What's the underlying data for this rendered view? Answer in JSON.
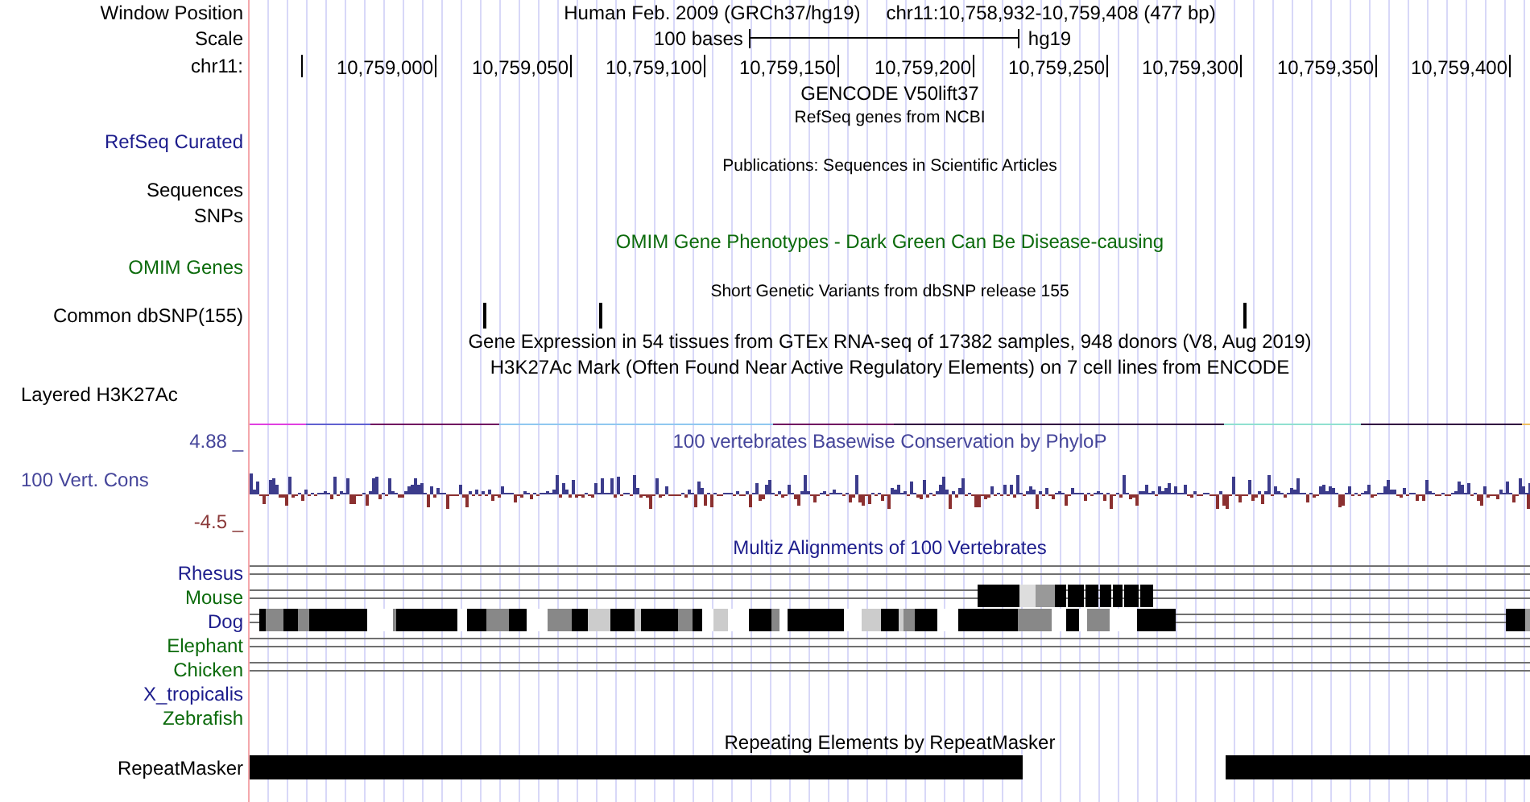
{
  "rows": [
    {
      "kind": "position",
      "label": {
        "text": "Window Position",
        "color": "#000000"
      },
      "assembly": "Human Feb. 2009 (GRCh37/hg19)",
      "position": "chr11:10,758,932-10,759,408 (477 bp)"
    },
    {
      "kind": "scale",
      "label": {
        "text": "Scale",
        "color": "#000000"
      },
      "length": "100 bases",
      "database": "hg19"
    },
    {
      "kind": "ruler",
      "label": {
        "text": "chr11:",
        "color": "#000000"
      },
      "ticks": [
        "10,759,000",
        "10,759,050",
        "10,759,100",
        "10,759,150",
        "10,759,200",
        "10,759,250",
        "10,759,300",
        "10,759,350",
        "10,759,400"
      ]
    },
    {
      "kind": "title",
      "title": {
        "text": "GENCODE V50lift37",
        "color": "#000000"
      }
    },
    {
      "kind": "note",
      "title": {
        "text": "RefSeq genes from NCBI",
        "color": "#000000"
      }
    },
    {
      "kind": "label",
      "label": {
        "text": "RefSeq Curated",
        "color": "#1c1c8c"
      }
    },
    {
      "kind": "note",
      "title": {
        "text": "Publications: Sequences in Scientific Articles",
        "color": "#000000"
      }
    },
    {
      "kind": "label",
      "label": {
        "text": "Sequences",
        "color": "#000000"
      }
    },
    {
      "kind": "label",
      "label": {
        "text": "SNPs",
        "color": "#000000"
      }
    },
    {
      "kind": "title",
      "title": {
        "text": "OMIM Gene Phenotypes - Dark Green Can Be Disease-causing",
        "color": "#0c6b0c"
      }
    },
    {
      "kind": "label",
      "label": {
        "text": "OMIM Genes",
        "color": "#0c6b0c"
      }
    },
    {
      "kind": "note",
      "title": {
        "text": "Short Genetic Variants from dbSNP release 155",
        "color": "#000000"
      }
    },
    {
      "kind": "snps",
      "label": {
        "text": "Common dbSNP(155)",
        "color": "#000000"
      }
    },
    {
      "kind": "title",
      "title": {
        "text": "Gene Expression in 54 tissues from GTEx RNA-seq of 17382 samples, 948 donors (V8, Aug 2019)",
        "color": "#000000"
      }
    },
    {
      "kind": "title",
      "title": {
        "text": "H3K27Ac Mark (Often Found Near Active Regulatory Elements) on 7 cell lines from ENCODE",
        "color": "#000000"
      }
    },
    {
      "kind": "composite",
      "label": {
        "text": "Layered H3K27Ac",
        "color": "#000000"
      }
    },
    {
      "kind": "signal"
    },
    {
      "kind": "axis",
      "label": {
        "text": "4.88 _",
        "color": "#45459a"
      },
      "title": {
        "text": "100 vertebrates Basewise Conservation by PhyloP",
        "color": "#45459a"
      }
    },
    {
      "kind": "wiggle",
      "label": {
        "text": "100 Vert. Cons",
        "color": "#45459a"
      }
    },
    {
      "kind": "axis",
      "label": {
        "text": "-4.5 _",
        "color": "#8b3a3a"
      }
    },
    {
      "kind": "title",
      "title": {
        "text": "Multiz Alignments of 100 Vertebrates",
        "color": "#1c1c8c"
      }
    },
    {
      "kind": "alignment",
      "label": {
        "text": "Rhesus",
        "color": "#1c1c8c"
      },
      "lines": true
    },
    {
      "kind": "alignment",
      "label": {
        "text": "Mouse",
        "color": "#0c6b0c"
      },
      "lines": true
    },
    {
      "kind": "alignment",
      "label": {
        "text": "Dog",
        "color": "#1c1c8c"
      },
      "lines": true
    },
    {
      "kind": "alignment",
      "label": {
        "text": "Elephant",
        "color": "#0c6b0c"
      },
      "lines": true
    },
    {
      "kind": "alignment",
      "label": {
        "text": "Chicken",
        "color": "#0c6b0c"
      },
      "lines": true
    },
    {
      "kind": "alignment",
      "label": {
        "text": "X_tropicalis",
        "color": "#1c1c8c"
      },
      "lines": false
    },
    {
      "kind": "alignment",
      "label": {
        "text": "Zebrafish",
        "color": "#0c6b0c"
      },
      "lines": false
    },
    {
      "kind": "title",
      "title": {
        "text": "Repeating Elements by RepeatMasker",
        "color": "#000000"
      }
    },
    {
      "kind": "repeats",
      "label": {
        "text": "RepeatMasker",
        "color": "#000000"
      }
    }
  ]
}
